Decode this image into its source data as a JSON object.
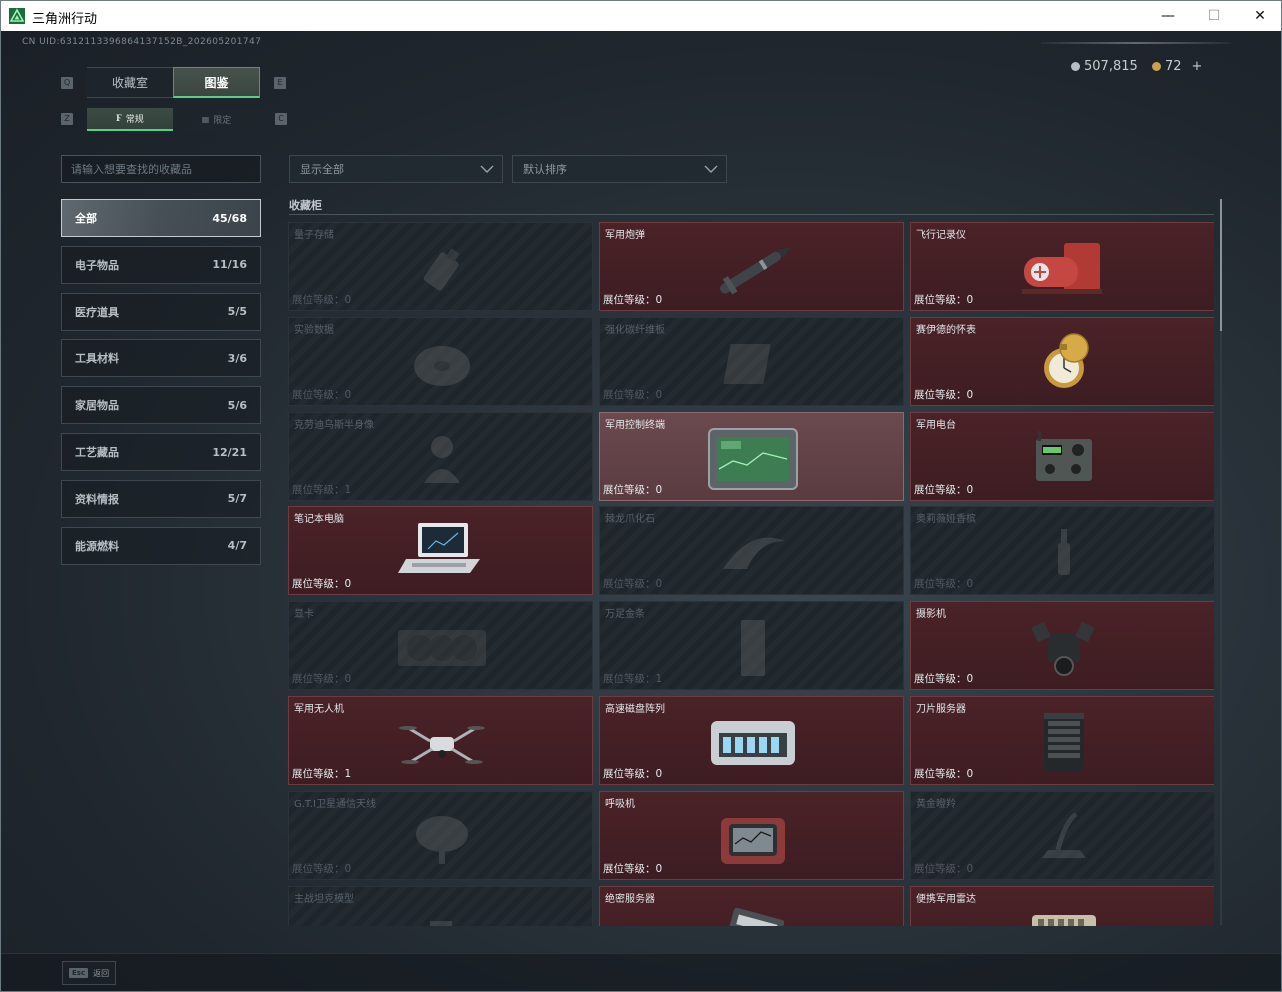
{
  "window": {
    "title": "三角洲行动",
    "minimize": "—",
    "maximize": "☐",
    "close": "✕"
  },
  "header": {
    "uid": "CN UID:6312113396864137152B_202605201747",
    "currency": [
      {
        "value": "507,815",
        "icon": "silver-coin-icon",
        "color": "#b7bfc4"
      },
      {
        "value": "72",
        "icon": "gold-coin-icon",
        "color": "#c9a24b",
        "add": "+"
      }
    ]
  },
  "tabs": {
    "left_key": "Q",
    "right_key": "E",
    "items": [
      {
        "label": "收藏室",
        "active": false
      },
      {
        "label": "图鉴",
        "active": true
      }
    ]
  },
  "subtabs": {
    "left_key": "Z",
    "right_key": "C",
    "items": [
      {
        "label": "常规",
        "icon": "lock-open-icon",
        "active": true
      },
      {
        "label": "限定",
        "icon": "grid-icon",
        "active": false
      }
    ]
  },
  "search": {
    "placeholder": "请输入想要查找的收藏品"
  },
  "filters": {
    "show": "显示全部",
    "sort": "默认排序"
  },
  "categories": [
    {
      "label": "全部",
      "count": "45/68",
      "active": true
    },
    {
      "label": "电子物品",
      "count": "11/16"
    },
    {
      "label": "医疗道具",
      "count": "5/5"
    },
    {
      "label": "工具材料",
      "count": "3/6"
    },
    {
      "label": "家居物品",
      "count": "5/6"
    },
    {
      "label": "工艺藏品",
      "count": "12/21"
    },
    {
      "label": "资料情报",
      "count": "5/7"
    },
    {
      "label": "能源燃料",
      "count": "4/7"
    }
  ],
  "section_title": "收藏柜",
  "level_prefix": "展位等级：",
  "items": [
    {
      "name": "量子存储",
      "level": "0",
      "state": "locked",
      "icon": "usb-drive-icon"
    },
    {
      "name": "军用炮弹",
      "level": "0",
      "state": "owned",
      "icon": "missile-icon"
    },
    {
      "name": "飞行记录仪",
      "level": "0",
      "state": "owned",
      "icon": "flight-recorder-icon"
    },
    {
      "name": "实验数据",
      "level": "0",
      "state": "locked",
      "icon": "data-disc-icon"
    },
    {
      "name": "强化碳纤维板",
      "level": "0",
      "state": "locked",
      "icon": "carbon-plate-icon"
    },
    {
      "name": "赛伊德的怀表",
      "level": "0",
      "state": "owned",
      "icon": "pocket-watch-icon"
    },
    {
      "name": "克劳迪乌斯半身像",
      "level": "1",
      "state": "locked",
      "icon": "bust-statue-icon"
    },
    {
      "name": "军用控制终端",
      "level": "0",
      "state": "highlight",
      "icon": "control-terminal-icon"
    },
    {
      "name": "军用电台",
      "level": "0",
      "state": "owned",
      "icon": "military-radio-icon"
    },
    {
      "name": "笔记本电脑",
      "level": "0",
      "state": "owned",
      "icon": "laptop-icon"
    },
    {
      "name": "棘龙爪化石",
      "level": "0",
      "state": "locked",
      "icon": "claw-fossil-icon"
    },
    {
      "name": "奥莉薇娅香槟",
      "level": "0",
      "state": "locked",
      "icon": "champagne-bottle-icon"
    },
    {
      "name": "显卡",
      "level": "0",
      "state": "locked",
      "icon": "graphics-card-icon"
    },
    {
      "name": "万足金条",
      "level": "1",
      "state": "locked",
      "icon": "gold-bar-icon"
    },
    {
      "name": "摄影机",
      "level": "0",
      "state": "owned",
      "icon": "video-camera-icon"
    },
    {
      "name": "军用无人机",
      "level": "1",
      "state": "owned",
      "icon": "drone-icon"
    },
    {
      "name": "高速磁盘阵列",
      "level": "0",
      "state": "owned",
      "icon": "disk-array-icon"
    },
    {
      "name": "刀片服务器",
      "level": "0",
      "state": "owned",
      "icon": "blade-server-icon"
    },
    {
      "name": "G.T.I卫星通信天线",
      "level": "0",
      "state": "locked",
      "icon": "satellite-dish-icon"
    },
    {
      "name": "呼吸机",
      "level": "0",
      "state": "owned",
      "icon": "ventilator-icon"
    },
    {
      "name": "黄金瞪羚",
      "level": "0",
      "state": "locked",
      "icon": "gazelle-statue-icon"
    },
    {
      "name": "主战坦克模型",
      "level": "",
      "state": "locked",
      "icon": "tank-model-icon"
    },
    {
      "name": "绝密服务器",
      "level": "",
      "state": "owned",
      "icon": "server-board-icon"
    },
    {
      "name": "便携军用雷达",
      "level": "",
      "state": "owned",
      "icon": "portable-radar-icon"
    }
  ],
  "footer": {
    "esc_key": "Esc",
    "back_label": "返回"
  }
}
